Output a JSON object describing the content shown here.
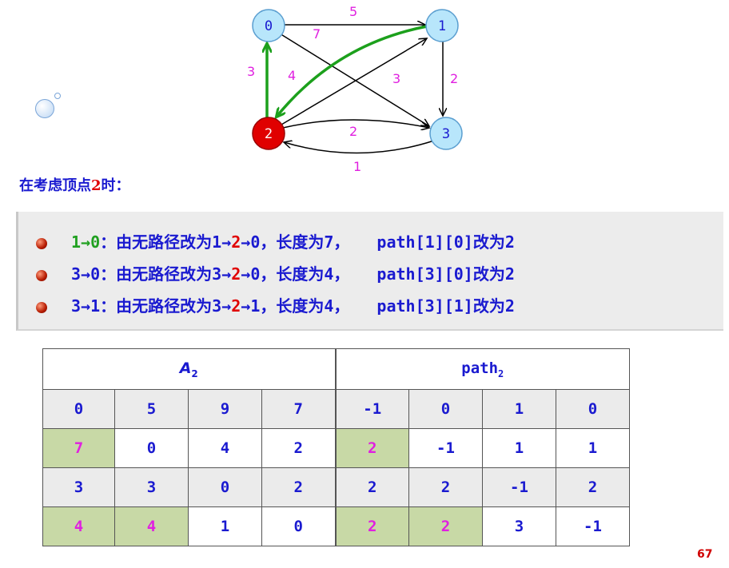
{
  "graph": {
    "nodes": [
      {
        "id": "0",
        "label": "0",
        "highlight": false
      },
      {
        "id": "1",
        "label": "1",
        "highlight": false
      },
      {
        "id": "2",
        "label": "2",
        "highlight": true
      },
      {
        "id": "3",
        "label": "3",
        "highlight": false
      }
    ],
    "edges": [
      {
        "from": "0",
        "to": "1",
        "weight": "5",
        "color": "#000000"
      },
      {
        "from": "0",
        "to": "3",
        "weight": "7",
        "color": "#000000"
      },
      {
        "from": "1",
        "to": "3",
        "weight": "2",
        "color": "#000000"
      },
      {
        "from": "1",
        "to": "2",
        "weight": "3",
        "color": "#1ca01c"
      },
      {
        "from": "2",
        "to": "0",
        "weight": "3",
        "color": "#1ca01c"
      },
      {
        "from": "2",
        "to": "1",
        "weight": "4",
        "color": "#000000"
      },
      {
        "from": "2",
        "to": "3",
        "weight": "2",
        "color": "#000000"
      },
      {
        "from": "3",
        "to": "2",
        "weight": "1",
        "color": "#000000"
      }
    ]
  },
  "heading": {
    "prefix": "在考虑顶点",
    "vertex": "2",
    "suffix": "时："
  },
  "updates": [
    {
      "pair_start": "1→",
      "pair_end": "0",
      "pair_green": true,
      "text1": "：由无路径改为1→",
      "mid": "2",
      "text2": "→0，长度为7，",
      "path_text": "path[1][0]改为2"
    },
    {
      "pair_start": "3→",
      "pair_end": "0",
      "pair_green": false,
      "text1": "：由无路径改为3→",
      "mid": "2",
      "text2": "→0，长度为4，",
      "path_text": "path[3][0]改为2"
    },
    {
      "pair_start": "3→",
      "pair_end": "1",
      "pair_green": false,
      "text1": "：由无路径改为3→",
      "mid": "2",
      "text2": "→1，长度为4，",
      "path_text": "path[3][1]改为2"
    }
  ],
  "table": {
    "a_header": "A",
    "a_sub": "2",
    "path_header": "path",
    "path_sub": "2",
    "rows": [
      {
        "a": [
          "0",
          "5",
          "9",
          "7"
        ],
        "path": [
          "-1",
          "0",
          "1",
          "0"
        ],
        "a_changed": [
          false,
          false,
          false,
          false
        ],
        "path_changed": [
          false,
          false,
          false,
          false
        ]
      },
      {
        "a": [
          "7",
          "0",
          "4",
          "2"
        ],
        "path": [
          "2",
          "-1",
          "1",
          "1"
        ],
        "a_changed": [
          true,
          false,
          false,
          false
        ],
        "path_changed": [
          true,
          false,
          false,
          false
        ]
      },
      {
        "a": [
          "3",
          "3",
          "0",
          "2"
        ],
        "path": [
          "2",
          "2",
          "-1",
          "2"
        ],
        "a_changed": [
          false,
          false,
          false,
          false
        ],
        "path_changed": [
          false,
          false,
          false,
          false
        ]
      },
      {
        "a": [
          "4",
          "4",
          "1",
          "0"
        ],
        "path": [
          "2",
          "2",
          "3",
          "-1"
        ],
        "a_changed": [
          true,
          true,
          false,
          false
        ],
        "path_changed": [
          true,
          true,
          false,
          false
        ]
      }
    ]
  },
  "page_number": "67",
  "colors": {
    "accent_text": "#1a1ad0",
    "highlight_red": "#e00000",
    "weight_magenta": "#e020e0",
    "changed_cell": "#c8d9a6",
    "node_fill": "#b8e6fb"
  }
}
